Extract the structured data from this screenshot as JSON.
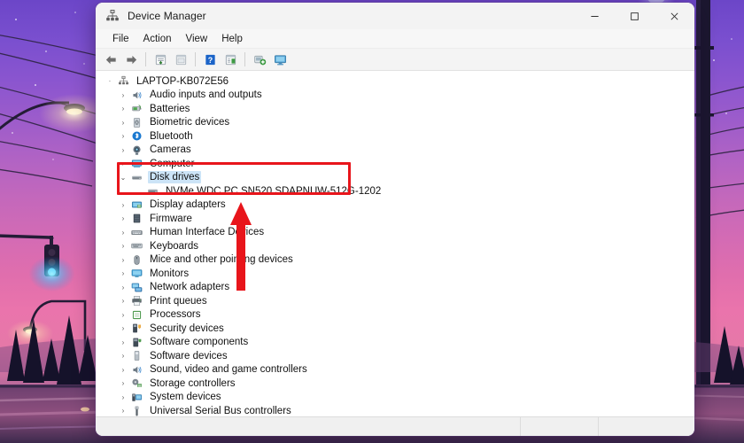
{
  "window": {
    "title": "Device Manager",
    "title_icon": "device-manager-icon",
    "controls": {
      "minimize": "–",
      "maximize": "☐",
      "close": "×",
      "minimize_name": "minimize-button",
      "maximize_name": "maximize-button",
      "close_name": "close-button"
    }
  },
  "menubar": {
    "items": [
      {
        "label": "File",
        "name": "menu-file"
      },
      {
        "label": "Action",
        "name": "menu-action"
      },
      {
        "label": "View",
        "name": "menu-view"
      },
      {
        "label": "Help",
        "name": "menu-help"
      }
    ]
  },
  "toolbar": {
    "buttons": [
      {
        "name": "back-button",
        "icon": "back-arrow-icon"
      },
      {
        "name": "forward-button",
        "icon": "forward-arrow-icon"
      },
      {
        "name": "properties-button",
        "icon": "properties-icon"
      },
      {
        "name": "show-hidden-button",
        "icon": "window-list-icon"
      },
      {
        "name": "help-button",
        "icon": "help-question-icon"
      },
      {
        "name": "update-driver-button",
        "icon": "update-driver-icon"
      },
      {
        "name": "scan-hardware-button",
        "icon": "scan-hardware-icon"
      },
      {
        "name": "add-legacy-button",
        "icon": "monitor-icon"
      }
    ]
  },
  "tree": {
    "root": {
      "label": "LAPTOP-KB072E56",
      "icon": "computer-root-icon",
      "expanded": true,
      "indent": 0
    },
    "nodes": [
      {
        "label": "Audio inputs and outputs",
        "icon": "audio-icon",
        "indent": 1,
        "expanded": false,
        "selected": false
      },
      {
        "label": "Batteries",
        "icon": "battery-icon",
        "indent": 1,
        "expanded": false,
        "selected": false
      },
      {
        "label": "Biometric devices",
        "icon": "biometric-icon",
        "indent": 1,
        "expanded": false,
        "selected": false
      },
      {
        "label": "Bluetooth",
        "icon": "bluetooth-icon",
        "indent": 1,
        "expanded": false,
        "selected": false
      },
      {
        "label": "Cameras",
        "icon": "camera-icon",
        "indent": 1,
        "expanded": false,
        "selected": false
      },
      {
        "label": "Computer",
        "icon": "computer-icon",
        "indent": 1,
        "expanded": false,
        "selected": false
      },
      {
        "label": "Disk drives",
        "icon": "disk-drive-icon",
        "indent": 1,
        "expanded": true,
        "selected": true
      },
      {
        "label": "NVMe WDC PC SN520 SDAPNUW-512G-1202",
        "icon": "disk-drive-icon",
        "indent": 2,
        "expanded": null,
        "selected": false
      },
      {
        "label": "Display adapters",
        "icon": "display-adapter-icon",
        "indent": 1,
        "expanded": false,
        "selected": false
      },
      {
        "label": "Firmware",
        "icon": "firmware-icon",
        "indent": 1,
        "expanded": false,
        "selected": false
      },
      {
        "label": "Human Interface Devices",
        "icon": "hid-icon",
        "indent": 1,
        "expanded": false,
        "selected": false
      },
      {
        "label": "Keyboards",
        "icon": "keyboard-icon",
        "indent": 1,
        "expanded": false,
        "selected": false
      },
      {
        "label": "Mice and other pointing devices",
        "icon": "mouse-icon",
        "indent": 1,
        "expanded": false,
        "selected": false
      },
      {
        "label": "Monitors",
        "icon": "monitor-icon",
        "indent": 1,
        "expanded": false,
        "selected": false
      },
      {
        "label": "Network adapters",
        "icon": "network-adapter-icon",
        "indent": 1,
        "expanded": false,
        "selected": false
      },
      {
        "label": "Print queues",
        "icon": "printer-icon",
        "indent": 1,
        "expanded": false,
        "selected": false
      },
      {
        "label": "Processors",
        "icon": "processor-icon",
        "indent": 1,
        "expanded": false,
        "selected": false
      },
      {
        "label": "Security devices",
        "icon": "security-device-icon",
        "indent": 1,
        "expanded": false,
        "selected": false
      },
      {
        "label": "Software components",
        "icon": "software-component-icon",
        "indent": 1,
        "expanded": false,
        "selected": false
      },
      {
        "label": "Software devices",
        "icon": "software-device-icon",
        "indent": 1,
        "expanded": false,
        "selected": false
      },
      {
        "label": "Sound, video and game controllers",
        "icon": "sound-controller-icon",
        "indent": 1,
        "expanded": false,
        "selected": false
      },
      {
        "label": "Storage controllers",
        "icon": "storage-controller-icon",
        "indent": 1,
        "expanded": false,
        "selected": false
      },
      {
        "label": "System devices",
        "icon": "system-device-icon",
        "indent": 1,
        "expanded": false,
        "selected": false
      },
      {
        "label": "Universal Serial Bus controllers",
        "icon": "usb-controller-icon",
        "indent": 1,
        "expanded": false,
        "selected": false
      }
    ],
    "chevron_collapsed": "›",
    "chevron_expanded": "˅"
  },
  "annotations": {
    "highlight_rect": {
      "name": "disk-drives-highlight-box",
      "color": "#e8151b"
    },
    "arrow": {
      "name": "pointer-arrow-up",
      "color": "#e8151b",
      "direction": "up"
    }
  },
  "colors": {
    "accent_red": "#e8151b",
    "selection_blue": "#cce4f7",
    "titlebar_bg": "#f3f3f3",
    "window_bg": "#ffffff",
    "wallpaper_top": "#6c46c8",
    "wallpaper_mid": "#e06ead",
    "wallpaper_bottom": "#4a3560"
  }
}
